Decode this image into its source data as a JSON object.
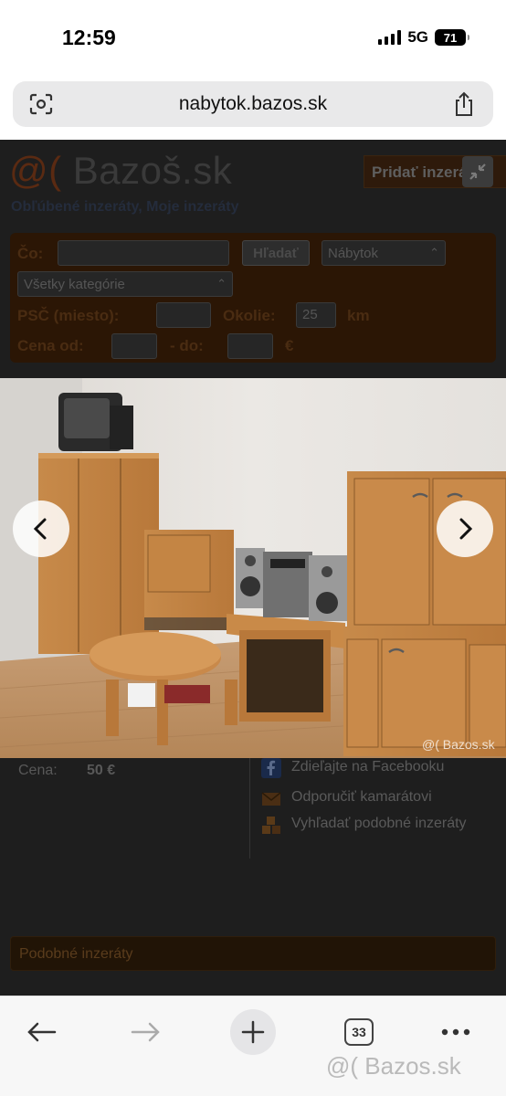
{
  "status_bar": {
    "time": "12:59",
    "network": "5G",
    "battery": "71"
  },
  "browser": {
    "url": "nabytok.bazos.sk"
  },
  "site": {
    "logo_symbol": "@(",
    "logo_text": "Bazoš.sk",
    "post_button": "Pridať inzerát",
    "fav_links": "Obľúbené inzeráty, Moje inzeráty"
  },
  "search": {
    "what_label": "Čo:",
    "what_value": "",
    "search_button": "Hľadať",
    "section_select": "Nábytok",
    "category_select": "Všetky kategórie",
    "psc_label": "PSČ (miesto):",
    "psc_value": "",
    "radius_label": "Okolie:",
    "radius_value": "25",
    "radius_unit": "km",
    "price_label": "Cena od:",
    "price_from": "",
    "price_sep": "- do:",
    "price_to": "",
    "currency": "€"
  },
  "photo": {
    "watermark": "@( Bazos.sk"
  },
  "listing": {
    "price_label": "Cena:",
    "price_value": "50 €"
  },
  "share": {
    "facebook": "Zdieľajte na Facebooku",
    "recommend": "Odporučiť kamarátovi",
    "similar_search": "Vyhľadať podobné inzeráty"
  },
  "similar_ads": "Podobné inzeráty",
  "toolbar": {
    "tabs_count": "33"
  },
  "footer_watermark": "@( Bazos.sk",
  "colors": {
    "accent": "#ff6600",
    "dim_overlay": "#1e1e1e"
  }
}
